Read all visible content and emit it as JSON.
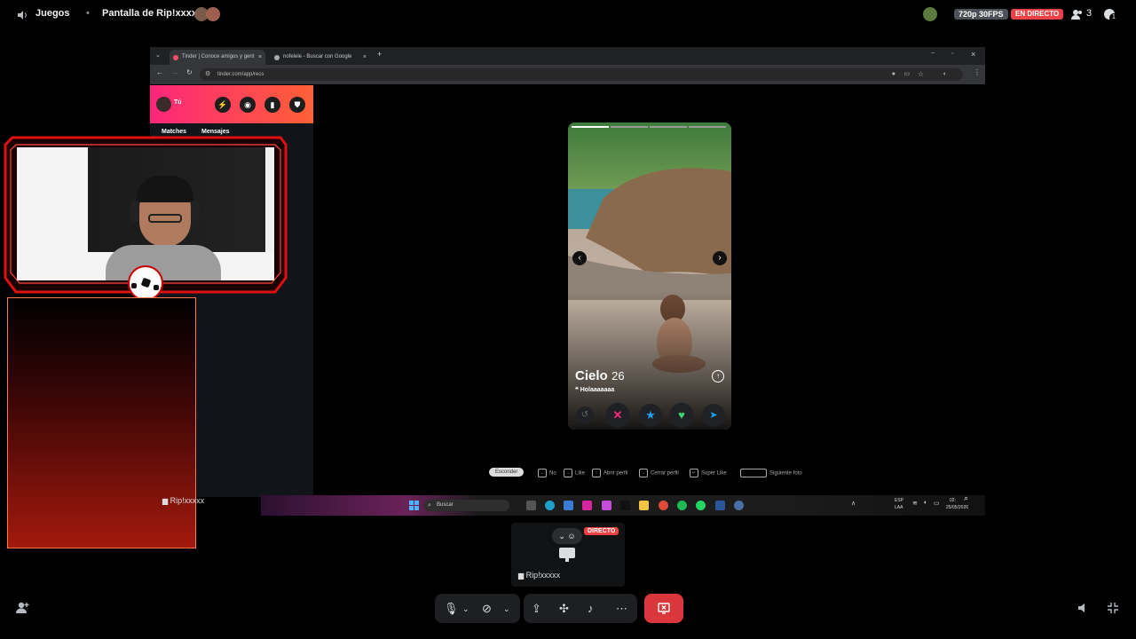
{
  "topbar": {
    "channel": "Juegos",
    "stream_title": "Pantalla de Rip!xxxxx",
    "quality": "720p 30FPS",
    "live_badge": "EN DIRECTO",
    "viewers": "3",
    "notif_count": "1"
  },
  "browser": {
    "tabs": [
      {
        "label": "Tinder | Conoce amigos y gent"
      },
      {
        "label": "nofelele - Buscar con Google"
      }
    ],
    "url": "tinder.com/app/recs",
    "tinder": {
      "user": "Tú",
      "nav": [
        "Matches",
        "Mensajes"
      ],
      "profile": {
        "name": "Cielo",
        "age": "26",
        "bio": "Holaaaaaaa"
      },
      "shortcuts": [
        {
          "key": "Esconder"
        },
        {
          "label": "No"
        },
        {
          "label": "Like"
        },
        {
          "label": "Abrir perfil"
        },
        {
          "label": "Cerrar perfil"
        },
        {
          "label": "Super Like"
        },
        {
          "label": "Siguiente foto"
        }
      ]
    },
    "taskbar": {
      "search": "Buscar",
      "lang1": "ESP",
      "lang2": "LAA",
      "time": "02:",
      "date": "25/05/2026"
    }
  },
  "webcam": {
    "username": "Rip!xxxxx"
  },
  "preview": {
    "live_badge": "DIRECTO",
    "username": "Rip!xxxxx"
  },
  "colors": {
    "live_red": "#ed4245",
    "tinder_gradient_start": "#fd267a",
    "tinder_gradient_end": "#ff6036",
    "disconnect_red": "#da373c"
  }
}
